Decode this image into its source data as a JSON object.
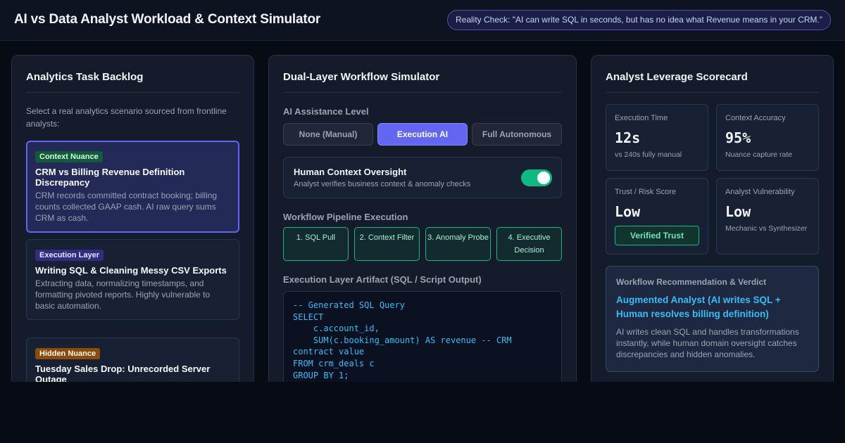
{
  "header": {
    "title": "AI vs Data Analyst Workload & Context Simulator",
    "reality_check": "Reality Check: \"AI can write SQL in seconds, but has no idea what Revenue means in your CRM.\""
  },
  "backlog": {
    "title": "Analytics Task Backlog",
    "intro": "Select a real analytics scenario sourced from frontline analysts:",
    "tasks": [
      {
        "badge": "Context Nuance",
        "title": "CRM vs Billing Revenue Definition Discrepancy",
        "desc": "CRM records committed contract booking; billing counts collected GAAP cash. AI raw query sums CRM as cash.",
        "selected": true
      },
      {
        "badge": "Execution Layer",
        "title": "Writing SQL & Cleaning Messy CSV Exports",
        "desc": "Extracting data, normalizing timestamps, and formatting pivoted reports. Highly vulnerable to basic automation.",
        "selected": false
      },
      {
        "badge": "Hidden Nuance",
        "title": "Tuesday Sales Drop: Unrecorded Server Outage",
        "desc": "",
        "selected": false
      }
    ]
  },
  "simulator": {
    "title": "Dual-Layer Workflow Simulator",
    "assist_label": "AI Assistance Level",
    "assist_options": [
      "None (Manual)",
      "Execution AI",
      "Full Autonomous"
    ],
    "assist_selected": "Execution AI",
    "oversight": {
      "title": "Human Context Oversight",
      "subtitle": "Analyst verifies business context & anomaly checks",
      "enabled": true
    },
    "pipeline_label": "Workflow Pipeline Execution",
    "pipeline_steps": [
      "1. SQL Pull",
      "2. Context Filter",
      "3. Anomaly Probe",
      "4. Executive Decision"
    ],
    "artifact_label": "Execution Layer Artifact (SQL / Script Output)",
    "artifact_code": "-- Generated SQL Query\nSELECT\n    c.account_id,\n    SUM(c.booking_amount) AS revenue -- CRM\ncontract value\nFROM crm_deals c\nGROUP BY 1;"
  },
  "scorecard": {
    "title": "Analyst Leverage Scorecard",
    "metrics": [
      {
        "label": "Execution Time",
        "value": "12s",
        "sub": "vs 240s fully manual"
      },
      {
        "label": "Context Accuracy",
        "value": "95%",
        "sub": "Nuance capture rate"
      },
      {
        "label": "Trust / Risk Score",
        "value": "Low",
        "action": "Verified Trust"
      },
      {
        "label": "Analyst Vulnerability",
        "value": "Low",
        "sub": "Mechanic vs Synthesizer"
      }
    ],
    "verdict": {
      "label": "Workflow Recommendation & Verdict",
      "title": "Augmented Analyst (AI writes SQL + Human resolves billing definition)",
      "body": "AI writes clean SQL and handles transformations instantly, while human domain oversight catches discrepancies and hidden anomalies."
    }
  },
  "colors": {
    "accent": "#6366f1",
    "success": "#10b981",
    "code": "#38bdf8",
    "background": "#070b14"
  }
}
